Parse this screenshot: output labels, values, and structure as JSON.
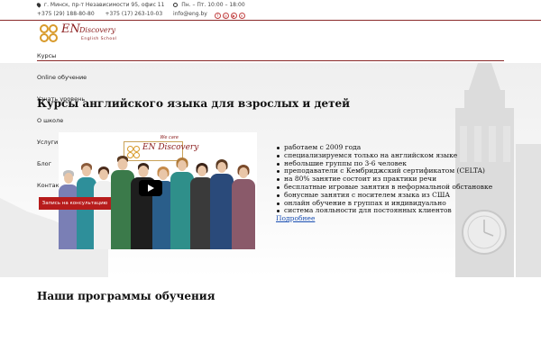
{
  "topbar": {
    "address": "г. Минск, пр-т Независимости 95, офис 11",
    "hours": "Пн. – Пт. 10:00 – 18:00",
    "phone1": "+375 (29) 188-80-80",
    "phone2": "+375 (17) 263-10-03",
    "email": "info@eng.by",
    "social": [
      {
        "icon": "facebook-icon",
        "glyph": "f"
      },
      {
        "icon": "instagram-icon",
        "glyph": "◎"
      },
      {
        "icon": "youtube-icon",
        "glyph": "▶"
      },
      {
        "icon": "vk-icon",
        "glyph": "к"
      }
    ]
  },
  "logo": {
    "en": "EN",
    "discovery": "Discovery",
    "subtitle": "English School"
  },
  "nav": {
    "items": [
      {
        "label": "Курсы"
      },
      {
        "label": "Online обучение"
      },
      {
        "label": "Узнать уровень"
      },
      {
        "label": "О школе"
      },
      {
        "label": "Услуги"
      },
      {
        "label": "Блог"
      },
      {
        "label": "Контакты"
      }
    ]
  },
  "hero": {
    "title": "Курсы английского языка для взрослых и детей",
    "cta_label": "Запись на консультацию",
    "video": {
      "tagline": "We care",
      "logo_en": "EN",
      "logo_disc": "Discovery"
    },
    "features": [
      "работаем с 2009 года",
      "специализируемся только на английском языке",
      "небольшие группы по 3-6 человек",
      "преподаватели с Кембриджский сертификатом (CELTA)",
      "на 80% занятие состоит из практики речи",
      "бесплатные игровые занятия в неформальной обстановке",
      "бонусные занятия с носителем языка из США",
      "онлайн обучение в группах и индивидуально",
      "система лояльности для постоянных клиентов"
    ],
    "more_label": "Подробнее"
  },
  "programs": {
    "title": "Наши программы обучения"
  },
  "colors": {
    "brand": "#8a1c1c",
    "accent_gold": "#d89a2a",
    "cta": "#b71c1c",
    "link": "#1a4fb3"
  }
}
